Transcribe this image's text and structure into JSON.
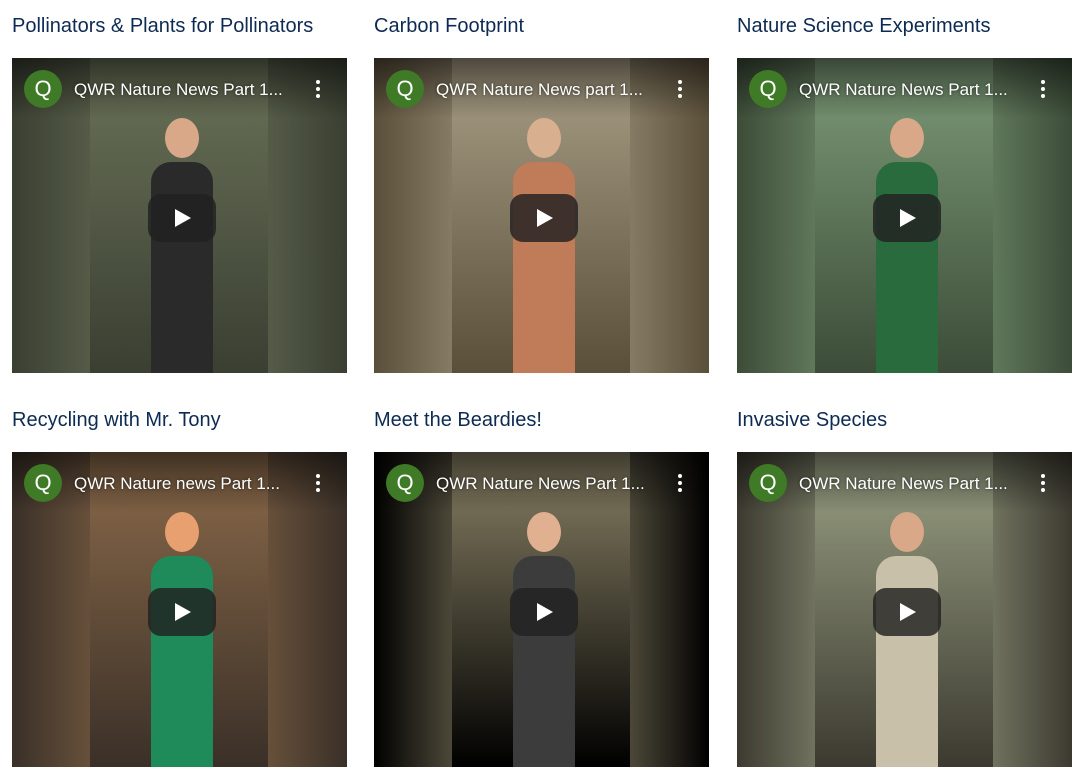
{
  "videos": [
    {
      "section_title": "Pollinators & Plants for Pollinators",
      "channel_initial": "Q",
      "video_title": "QWR Nature News Part 1...",
      "theme": {
        "strip": "#6a7258",
        "side": "#3a3f32",
        "accent": "#2a2a2a",
        "skin": "#d9a888"
      }
    },
    {
      "section_title": "Carbon Footprint",
      "channel_initial": "Q",
      "video_title": "QWR Nature News part 1...",
      "theme": {
        "strip": "#a99f86",
        "side": "#5a4f3a",
        "accent": "#c07c58",
        "skin": "#d8b090"
      }
    },
    {
      "section_title": "Nature Science Experiments",
      "channel_initial": "Q",
      "video_title": "QWR Nature News Part 1...",
      "theme": {
        "strip": "#7d9b78",
        "side": "#3c4c38",
        "accent": "#2a6b3e",
        "skin": "#d8a888"
      }
    },
    {
      "section_title": "Recycling with Mr. Tony",
      "channel_initial": "Q",
      "video_title": "QWR Nature news Part 1...",
      "theme": {
        "strip": "#8b6a4a",
        "side": "#3a3028",
        "accent": "#1f8a5a",
        "skin": "#e8a070"
      }
    },
    {
      "section_title": "Meet the Beardies!",
      "channel_initial": "Q",
      "video_title": "QWR Nature News Part 1...",
      "theme": {
        "strip": "#8a8266",
        "side": "#000000",
        "accent": "#3c3c3c",
        "skin": "#e0b090"
      }
    },
    {
      "section_title": "Invasive Species",
      "channel_initial": "Q",
      "video_title": "QWR Nature News Part 1...",
      "theme": {
        "strip": "#9aa184",
        "side": "#3c3a30",
        "accent": "#c8c0a8",
        "skin": "#d8a888"
      }
    }
  ],
  "colors": {
    "title_text": "#0d2a52",
    "avatar_bg": "#3f7a26"
  }
}
